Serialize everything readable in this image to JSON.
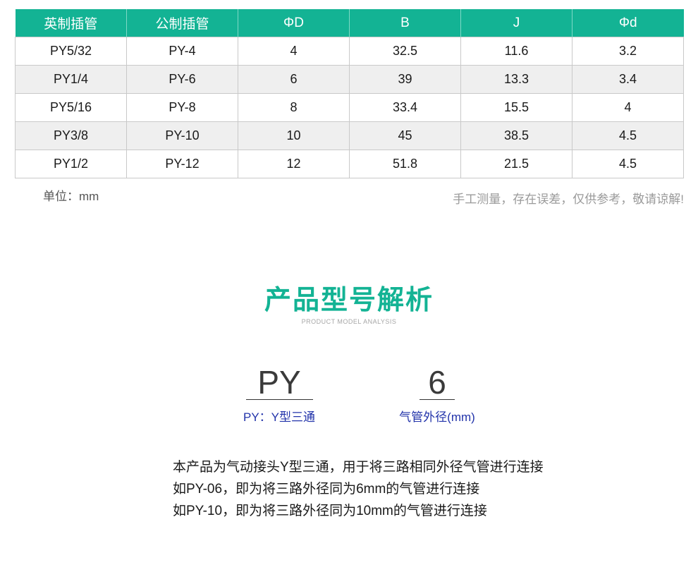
{
  "table": {
    "headers": [
      "英制插管",
      "公制插管",
      "ΦD",
      "B",
      "J",
      "Φd"
    ],
    "rows": [
      [
        "PY5/32",
        "PY-4",
        "4",
        "32.5",
        "11.6",
        "3.2"
      ],
      [
        "PY1/4",
        "PY-6",
        "6",
        "39",
        "13.3",
        "3.4"
      ],
      [
        "PY5/16",
        "PY-8",
        "8",
        "33.4",
        "15.5",
        "4"
      ],
      [
        "PY3/8",
        "PY-10",
        "10",
        "45",
        "38.5",
        "4.5"
      ],
      [
        "PY1/2",
        "PY-12",
        "12",
        "51.8",
        "21.5",
        "4.5"
      ]
    ],
    "header_color": "#13b394",
    "stripe_color": "#efefef"
  },
  "notes": {
    "unit": "单位：mm",
    "disclaimer": "手工测量，存在误差，仅供参考，敬请谅解!"
  },
  "analysis": {
    "title": "产品型号解析",
    "subtitle": "PRODUCT MODEL ANALYSIS",
    "title_color": "#13b394",
    "parts": [
      {
        "code": "PY",
        "caption": "PY：Y型三通"
      },
      {
        "code": "6",
        "caption": "气管外径(mm)"
      }
    ],
    "caption_color": "#2233aa"
  },
  "description": {
    "lines": [
      "本产品为气动接头Y型三通，用于将三路相同外径气管进行连接",
      "如PY-06，即为将三路外径同为6mm的气管进行连接",
      "如PY-10，即为将三路外径同为10mm的气管进行连接"
    ]
  }
}
